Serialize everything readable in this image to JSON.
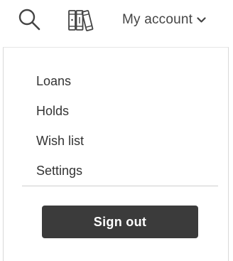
{
  "header": {
    "search_icon": "search-icon",
    "library_icon": "books-icon",
    "account_label": "My account",
    "account_chevron_icon": "chevron-down-icon"
  },
  "account_menu": {
    "items": [
      {
        "label": "Loans"
      },
      {
        "label": "Holds"
      },
      {
        "label": "Wish list"
      },
      {
        "label": "Settings"
      }
    ],
    "sign_out_label": "Sign out"
  },
  "colors": {
    "button_background": "#3b3b3b",
    "button_text": "#ffffff",
    "text": "#333333",
    "divider": "#cfcfcf"
  }
}
